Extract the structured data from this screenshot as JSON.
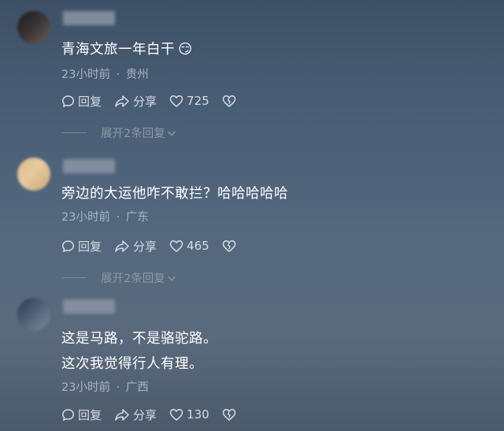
{
  "comments": [
    {
      "text_lines": [
        "青海文旅一年白干"
      ],
      "emoji": "😏",
      "time": "23小时前",
      "location": "贵州",
      "reply_label": "回复",
      "share_label": "分享",
      "likes": "725",
      "expand_label": "展开2条回复"
    },
    {
      "text_lines": [
        "旁边的大运他咋不敢拦？哈哈哈哈哈"
      ],
      "time": "23小时前",
      "location": "广东",
      "reply_label": "回复",
      "share_label": "分享",
      "likes": "465",
      "expand_label": "展开2条回复"
    },
    {
      "text_lines": [
        "这是马路，不是骆驼路。",
        "这次我觉得行人有理。"
      ],
      "time": "23小时前",
      "location": "广西",
      "reply_label": "回复",
      "share_label": "分享",
      "likes": "130"
    }
  ],
  "separator": "·"
}
